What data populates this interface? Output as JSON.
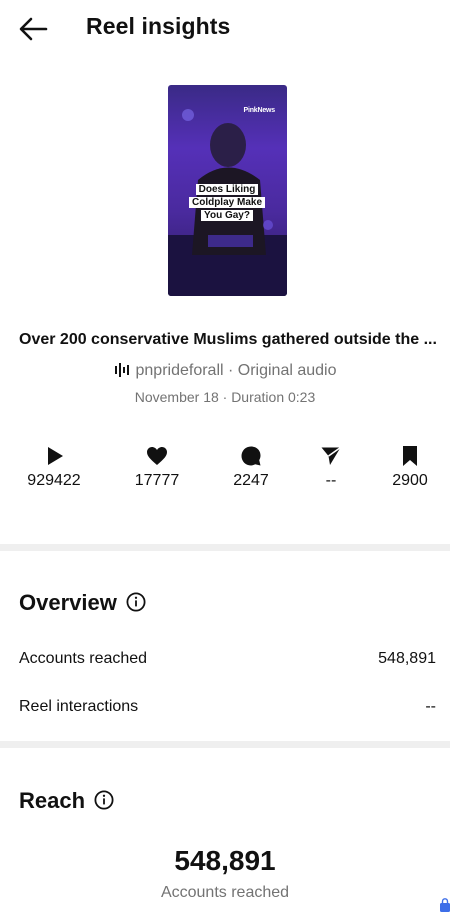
{
  "header": {
    "title": "Reel insights",
    "back_icon": "arrow-left-icon"
  },
  "reel": {
    "thumbnail": {
      "brand": "PinkNews",
      "caption": "Does Liking Coldplay Make You Gay?"
    },
    "title": "Over 200 conservative Muslims gathered outside the ...",
    "audio_icon": "audio-wave-icon",
    "audio": "pnprideforall · Original audio",
    "meta": "November 18 · Duration 0:23"
  },
  "stats": [
    {
      "icon": "play-icon",
      "value": "929422"
    },
    {
      "icon": "heart-icon",
      "value": "17777"
    },
    {
      "icon": "comment-icon",
      "value": "2247"
    },
    {
      "icon": "share-icon",
      "value": "--"
    },
    {
      "icon": "bookmark-icon",
      "value": "2900"
    }
  ],
  "overview": {
    "title": "Overview",
    "info_icon": "info-icon",
    "rows": [
      {
        "label": "Accounts reached",
        "value": "548,891"
      },
      {
        "label": "Reel interactions",
        "value": "--"
      }
    ]
  },
  "reach": {
    "title": "Reach",
    "info_icon": "info-icon",
    "number": "548,891",
    "caption": "Accounts reached"
  }
}
